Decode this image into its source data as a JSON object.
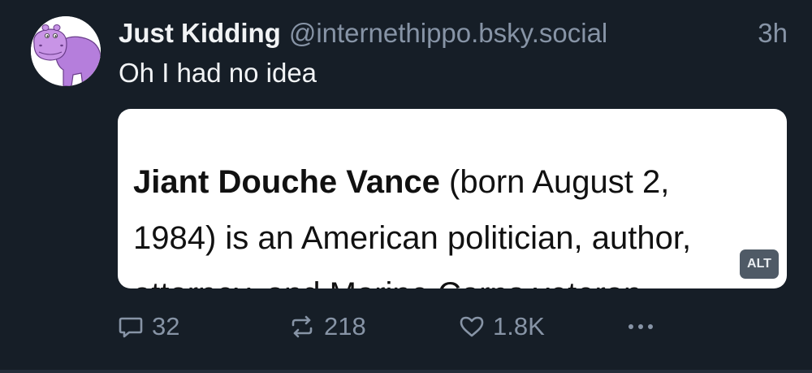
{
  "post": {
    "author": {
      "display_name": "Just Kidding",
      "handle": "@internethippo.bsky.social",
      "avatar_icon": "hippo-avatar-icon"
    },
    "timestamp": "3h",
    "text": "Oh I had no idea",
    "embed": {
      "excerpt_bold": "Jiant Douche Vance",
      "excerpt_line1_rest": " (born August 2,",
      "excerpt_line2": "1984) is an American politician, author,",
      "excerpt_line3": "attorney, and Marine Corps veteran",
      "alt_label": "ALT"
    },
    "actions": {
      "reply_count": "32",
      "repost_count": "218",
      "like_count": "1.8K",
      "reply_icon": "reply-icon",
      "repost_icon": "repost-icon",
      "like_icon": "heart-icon",
      "more_icon": "more-options-icon"
    }
  },
  "colors": {
    "background": "#161e27",
    "text_primary": "#f1f3f5",
    "text_secondary": "#8794a6",
    "alt_badge": "#4f5a66",
    "avatar_hippo": "#b57edc"
  }
}
